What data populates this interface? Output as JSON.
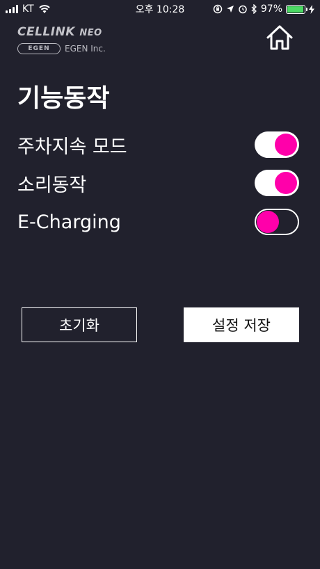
{
  "status_bar": {
    "carrier": "KT",
    "time": "오후 10:28",
    "battery_percent": "97%",
    "battery_level": 0.97,
    "icons": [
      "signal-icon",
      "wifi-icon",
      "screen-lock-icon",
      "location-icon",
      "alarm-icon",
      "bluetooth-icon",
      "battery-icon",
      "charging-icon"
    ]
  },
  "header": {
    "brand": "CELLINK",
    "brand_suffix": "NEO",
    "company_badge": "EGEN",
    "company": "EGEN Inc.",
    "home_icon": "home-icon"
  },
  "page": {
    "title": "기능동작"
  },
  "settings": [
    {
      "label": "주차지속 모드",
      "enabled": true
    },
    {
      "label": "소리동작",
      "enabled": true
    },
    {
      "label": "E-Charging",
      "enabled": false
    }
  ],
  "buttons": {
    "reset_label": "초기화",
    "save_label": "설정 저장"
  },
  "colors": {
    "background": "#21212d",
    "accent": "#ff00aa",
    "text": "#ffffff",
    "battery": "#4cd964"
  }
}
